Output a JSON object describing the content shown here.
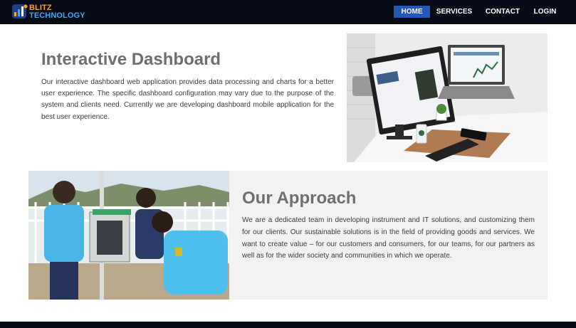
{
  "brand": {
    "name_line1": "BLITZ",
    "name_line2": "TECHNOLOGY",
    "icon": "blitz-logo-icon"
  },
  "nav": {
    "items": [
      {
        "label": "HOME",
        "active": true
      },
      {
        "label": "SERVICES",
        "active": false
      },
      {
        "label": "CONTACT",
        "active": false
      },
      {
        "label": "LOGIN",
        "active": false
      }
    ]
  },
  "dashboard_section": {
    "title": "Interactive Dashboard",
    "text": "Our interactive dashboard web application provides data processing and charts for a better user experience. The specific dashboard configuration may vary due to the purpose of the system and clients need. Currently we are developing dashboard mobile application for the best user experience.",
    "image": "laptop-and-monitor-dashboard-photo"
  },
  "approach_section": {
    "title": "Our Approach",
    "text": "We are a dedicated team in developing instrument and IT solutions, and customizing them for our clients. Our sustainable solutions is in the field of providing goods and services. We want to create value – for our customers and consumers, for our teams, for our partners as well as for the wider society and communities in which we operate.",
    "image": "field-team-instrument-photo"
  },
  "colors": {
    "navbar_bg": "#070b16",
    "nav_active_bg": "#2458b8",
    "heading": "#6f6f6f",
    "body_text": "#3c3c3c",
    "panel_bg": "#f2f2f2",
    "logo_orange": "#f5a623",
    "logo_blue": "#3fa9f5"
  }
}
